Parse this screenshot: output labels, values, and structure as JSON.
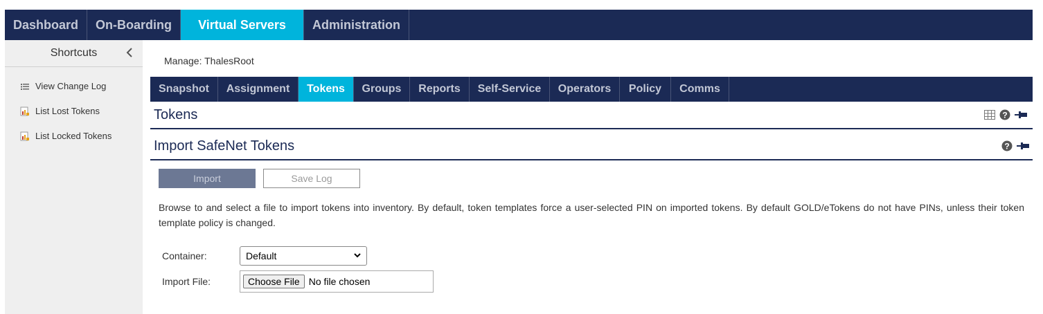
{
  "top_nav": {
    "tabs": [
      {
        "label": "Dashboard"
      },
      {
        "label": "On-Boarding"
      },
      {
        "label": "Virtual Servers"
      },
      {
        "label": "Administration"
      }
    ],
    "active": "Virtual Servers"
  },
  "sidebar": {
    "title": "Shortcuts",
    "items": [
      {
        "label": "View Change Log",
        "icon": "list-icon"
      },
      {
        "label": "List Lost Tokens",
        "icon": "report-icon"
      },
      {
        "label": "List Locked Tokens",
        "icon": "report-icon"
      }
    ]
  },
  "manage": {
    "label": "Manage: ThalesRoot"
  },
  "sub_nav": {
    "tabs": [
      {
        "label": "Snapshot"
      },
      {
        "label": "Assignment"
      },
      {
        "label": "Tokens"
      },
      {
        "label": "Groups"
      },
      {
        "label": "Reports"
      },
      {
        "label": "Self-Service"
      },
      {
        "label": "Operators"
      },
      {
        "label": "Policy"
      },
      {
        "label": "Comms"
      }
    ],
    "active": "Tokens"
  },
  "tokens_section": {
    "title": "Tokens"
  },
  "import_section": {
    "title": "Import SafeNet Tokens",
    "import_button": "Import",
    "save_log_button": "Save Log",
    "description": "Browse to and select a file to import tokens into inventory. By default, token templates force a user-selected PIN on imported tokens. By default GOLD/eTokens do not have PINs, unless their token template policy is changed.",
    "container_label": "Container:",
    "container_value": "Default",
    "import_file_label": "Import File:",
    "choose_file_button": "Choose File",
    "file_status": "No file chosen"
  },
  "colors": {
    "nav_bg": "#1b2a55",
    "active_tab": "#00b4dc",
    "sidebar_bg": "#efefef"
  }
}
